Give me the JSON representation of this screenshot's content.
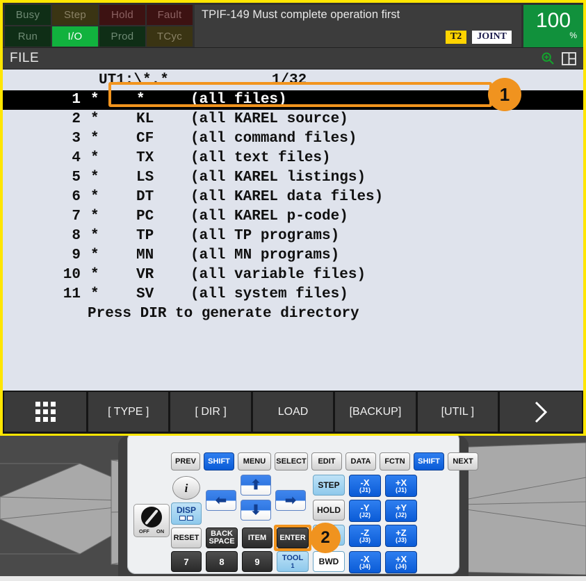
{
  "status_lights": [
    {
      "label": "Busy",
      "state": "off"
    },
    {
      "label": "Step",
      "state": "off"
    },
    {
      "label": "Hold",
      "state": "off"
    },
    {
      "label": "Fault",
      "state": "off"
    },
    {
      "label": "Run",
      "state": "off"
    },
    {
      "label": "I/O",
      "state": "on"
    },
    {
      "label": "Prod",
      "state": "off"
    },
    {
      "label": "TCyc",
      "state": "off"
    }
  ],
  "message": "TPIF-149 Must complete operation first",
  "tags": {
    "mode": "T2",
    "coord": "JOINT"
  },
  "override": {
    "value": "100",
    "unit": "%"
  },
  "titlebar": {
    "title": "FILE",
    "zoom_icon": "zoom-in-icon",
    "split_icon": "split-screen-icon"
  },
  "file_list": {
    "path": "UT1:\\*.*",
    "page": "1/32",
    "note": "Press DIR to generate directory",
    "rows": [
      {
        "idx": "1",
        "name": "*",
        "ext": "*",
        "desc": "(all files)",
        "selected": true
      },
      {
        "idx": "2",
        "name": "*",
        "ext": "KL",
        "desc": "(all KAREL source)",
        "selected": false
      },
      {
        "idx": "3",
        "name": "*",
        "ext": "CF",
        "desc": "(all command files)",
        "selected": false
      },
      {
        "idx": "4",
        "name": "*",
        "ext": "TX",
        "desc": "(all text files)",
        "selected": false
      },
      {
        "idx": "5",
        "name": "*",
        "ext": "LS",
        "desc": "(all KAREL listings)",
        "selected": false
      },
      {
        "idx": "6",
        "name": "*",
        "ext": "DT",
        "desc": "(all KAREL data files)",
        "selected": false
      },
      {
        "idx": "7",
        "name": "*",
        "ext": "PC",
        "desc": "(all KAREL p-code)",
        "selected": false
      },
      {
        "idx": "8",
        "name": "*",
        "ext": "TP",
        "desc": "(all TP programs)",
        "selected": false
      },
      {
        "idx": "9",
        "name": "*",
        "ext": "MN",
        "desc": "(all MN programs)",
        "selected": false
      },
      {
        "idx": "10",
        "name": "*",
        "ext": "VR",
        "desc": "(all variable files)",
        "selected": false
      },
      {
        "idx": "11",
        "name": "*",
        "ext": "SV",
        "desc": "(all system files)",
        "selected": false
      }
    ]
  },
  "function_keys": {
    "menu_icon": "grid-menu-icon",
    "labels": [
      "[ TYPE ]",
      "[ DIR ]",
      "LOAD",
      "[BACKUP]",
      "[UTIL ]"
    ],
    "next_icon": "chevron-right-icon"
  },
  "keypad": {
    "row_top": [
      "PREV",
      "SHIFT",
      "MENU",
      "SELECT",
      "EDIT",
      "DATA",
      "FCTN",
      "SHIFT",
      "NEXT"
    ],
    "info": "i",
    "disp": "DISP",
    "reset": "RESET",
    "backspace_line1": "BACK",
    "backspace_line2": "SPACE",
    "item": "ITEM",
    "enter": "ENTER",
    "tool_label": "TOOL",
    "tool_sub": "1",
    "step": "STEP",
    "hold": "HOLD",
    "bwd": "BWD",
    "numbers": [
      "7",
      "8",
      "9"
    ],
    "knob": {
      "off": "OFF",
      "on": "ON"
    },
    "jog": [
      {
        "axis": "-X",
        "joint": "(J1)"
      },
      {
        "axis": "+X",
        "joint": "(J1)"
      },
      {
        "axis": "-Y",
        "joint": "(J2)"
      },
      {
        "axis": "+Y",
        "joint": "(J2)"
      },
      {
        "axis": "-Z",
        "joint": "(J3)"
      },
      {
        "axis": "+Z",
        "joint": "(J3)"
      },
      {
        "axis": "-X",
        "joint": "(J4)"
      },
      {
        "axis": "+X",
        "joint": "(J4)"
      }
    ],
    "arrows": [
      "left-arrow-key",
      "up-arrow-key",
      "down-arrow-key",
      "right-arrow-key"
    ]
  },
  "annotations": [
    {
      "id": "1",
      "target": "selected-file-row"
    },
    {
      "id": "2",
      "target": "enter-key"
    }
  ],
  "colors": {
    "accent": "#f0931f",
    "border": "#ffe600",
    "io_on": "#11b23e",
    "override": "#11913c",
    "mode_tag": "#ffd400",
    "screen_bg": "#dfe3ec"
  }
}
